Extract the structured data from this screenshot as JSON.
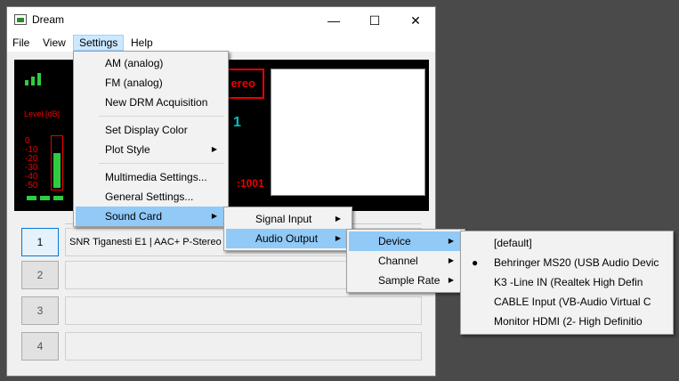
{
  "window": {
    "title": "Dream"
  },
  "titlebar": {
    "minimize": "—",
    "maximize": "☐",
    "close": "✕"
  },
  "menubar": {
    "file": "File",
    "view": "View",
    "settings": "Settings",
    "help": "Help"
  },
  "display": {
    "level_label": "Level [dB]",
    "scale": [
      "0",
      "-10",
      "-20",
      "-30",
      "-40",
      "-50"
    ],
    "stereo_text": "ereo",
    "cyan_text": "1",
    "red_code": ":1001",
    "level_fraction": 0.68
  },
  "services": [
    {
      "number": "1",
      "text": "SNR Tiganesti E1  |  AAC+ P-Stereo"
    },
    {
      "number": "2",
      "text": ""
    },
    {
      "number": "3",
      "text": ""
    },
    {
      "number": "4",
      "text": ""
    }
  ],
  "settings_menu": {
    "am": "AM (analog)",
    "fm": "FM (analog)",
    "drm": "New DRM Acquisition",
    "display_color": "Set Display Color",
    "plot_style": "Plot Style",
    "multimedia": "Multimedia Settings...",
    "general": "General Settings...",
    "sound_card": "Sound Card"
  },
  "sound_card_menu": {
    "signal_input": "Signal Input",
    "audio_output": "Audio Output"
  },
  "audio_output_menu": {
    "device": "Device",
    "channel": "Channel",
    "sample_rate": "Sample Rate"
  },
  "device_menu": {
    "items": [
      "[default]",
      "Behringer MS20 (USB Audio Devic",
      "K3 -Line IN (Realtek High Defin",
      "CABLE Input (VB-Audio Virtual C",
      "Monitor HDMI (2- High Definitio"
    ],
    "selected_marker": "●"
  },
  "colors": {
    "accent": "#91c9f7",
    "display_bg": "#000000",
    "level_green": "#2ecc40",
    "display_red": "#e00000"
  }
}
